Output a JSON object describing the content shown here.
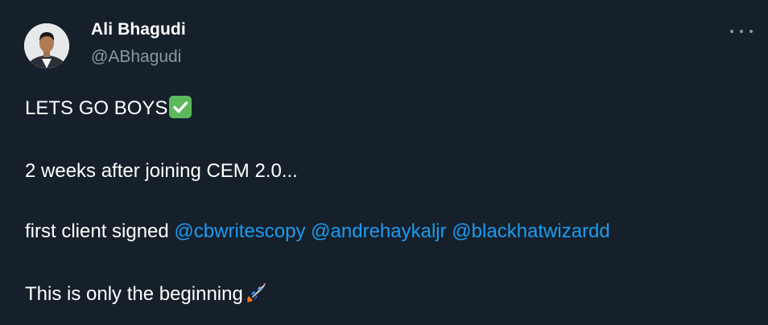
{
  "author": {
    "name": "Ali Bhagudi",
    "handle": "@ABhagudi"
  },
  "tweet": {
    "line1": "LETS GO BOYS",
    "line2": "2 weeks after joining CEM 2.0...",
    "line3_prefix": "first client signed",
    "mentions": [
      "@cbwritescopy",
      "@andrehaykaljr",
      "@blackhatwizardd"
    ],
    "line4": "This is only the beginning"
  },
  "icons": {
    "check": "white-heavy-check-mark-emoji",
    "rocket": "rocket-emoji",
    "more": "more-options-icon"
  },
  "colors": {
    "background": "#15202b",
    "text": "#ffffff",
    "secondary": "#8b98a5",
    "link": "#1d9bf0"
  }
}
